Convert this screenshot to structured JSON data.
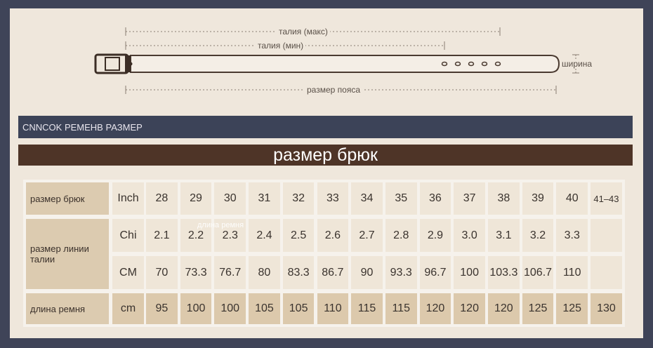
{
  "diagram": {
    "label_max": "талия (макс)",
    "label_min": "талия (мин)",
    "label_width": "ширина",
    "label_belt": "размер пояса"
  },
  "banner_top": "CNNCOK РЕМЕНВ РАЗМЕР",
  "banner_title": "размер брюк",
  "table": {
    "row_pants": {
      "label": "размер брюк",
      "unit": "Inch",
      "values": [
        "28",
        "29",
        "30",
        "31",
        "32",
        "33",
        "34",
        "35",
        "36",
        "37",
        "38",
        "39",
        "40",
        "41–43"
      ]
    },
    "row_waist_label": "размер линии талии",
    "row_chi": {
      "unit": "Chi",
      "values": [
        "2.1",
        "2.2",
        "2.3",
        "2.4",
        "2.5",
        "2.6",
        "2.7",
        "2.8",
        "2.9",
        "3.0",
        "3.1",
        "3.2",
        "3.3",
        ""
      ]
    },
    "row_cm": {
      "unit": "CM",
      "values": [
        "70",
        "73.3",
        "76.7",
        "80",
        "83.3",
        "86.7",
        "90",
        "93.3",
        "96.7",
        "100",
        "103.3",
        "106.7",
        "110",
        ""
      ]
    },
    "row_belt": {
      "label": "длина ремня",
      "unit": "cm",
      "values": [
        "95",
        "100",
        "100",
        "105",
        "105",
        "110",
        "115",
        "115",
        "120",
        "120",
        "120",
        "125",
        "125",
        "130"
      ]
    },
    "watermark": "длина ремня"
  },
  "colors": {
    "frame": "#3f4458",
    "background": "#efe7dc",
    "banner_dark": "#3c4358",
    "banner_brown": "#4e3427",
    "label_cell": "#dccbb0"
  }
}
